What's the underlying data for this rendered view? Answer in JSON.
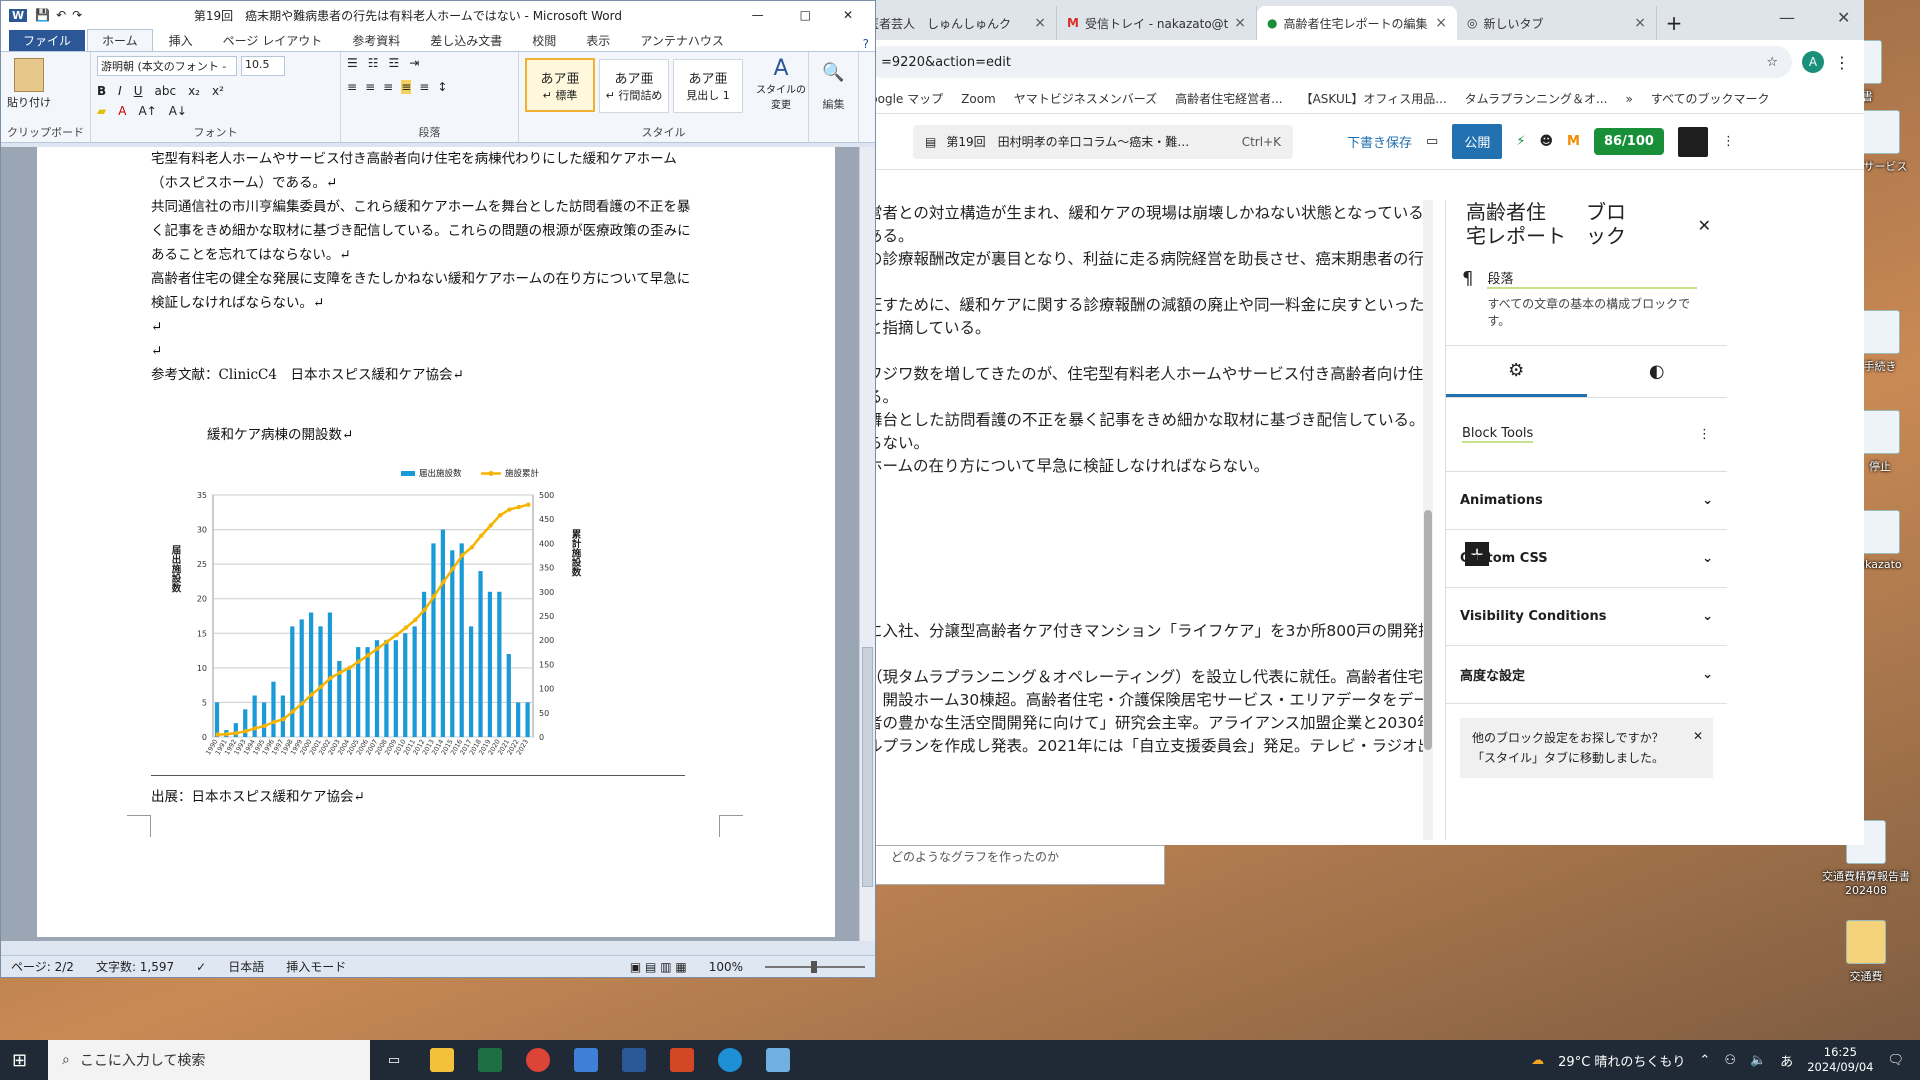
{
  "desktop": {
    "icons": [
      {
        "label": "ーサービス",
        "x_hint": "right"
      },
      {
        "label": "手続き"
      },
      {
        "label": "停止"
      },
      {
        "label": "akazato"
      },
      {
        "label": "交通費精算報告書\n202408"
      },
      {
        "label": "交通費"
      }
    ],
    "top_icons": [
      "文書"
    ]
  },
  "browser": {
    "tabs": [
      {
        "label": "医者芸人　しゅんしゅんク",
        "active": false
      },
      {
        "label": "受信トレイ - nakazato@ta",
        "active": false
      },
      {
        "label": "高齢者住宅レポートの編集",
        "active": true
      },
      {
        "label": "新しいタブ",
        "active": false
      }
    ],
    "url": "=9220&action=edit",
    "bookmarks": [
      "Google マップ",
      "Zoom",
      "ヤマトビジネスメンバーズ",
      "高齢者住宅経営者...",
      "【ASKUL】オフィス用品...",
      "タムラプランニング＆オ...",
      "すべてのブックマーク"
    ],
    "wp": {
      "doc_title": "第19回　田村明孝の辛口コラム〜癌末・難…",
      "shortcut": "Ctrl+K",
      "save_draft": "下書き保存",
      "publish": "公開",
      "score": "86/100"
    },
    "editor_lines": [
      "営者との対立構造が生まれ、緩和ケアの現場は崩壊しかねない状態となっている。",
      "ある。",
      "の診療報酬改定が裏目となり、利益に走る病院経営を助長させ、癌末期患者の行き場",
      "",
      "正すために、緩和ケアに関する診療報酬の減額の廃止や同一料金に戻すといった改善",
      "と指摘している。",
      "",
      "ワジワ数を増してきたのが、住宅型有料老人ホームやサービス付き高齢者向け住宅を",
      "る。",
      "舞台とした訪問看護の不正を暴く記事をきめ細かな取材に基づき配信している。これ",
      "らない。",
      "ホームの在り方について早急に検証しなければならない。"
    ],
    "editor_lines_2": [
      "に入社、分譲型高齢者ケア付きマンション「ライフケア」を3か所800戸の開発担当",
      "",
      "（現タムラプランニング＆オペレーティング）を設立し代表に就任。高齢者住宅開",
      "。開設ホーム30棟超。高齢者住宅・介護保険居宅サービス・エリアデータをデータベ",
      "者の豊かな生活空間開発に向けて」研究会主宰。アライアンス加盟企業と2030年の",
      "ルプランを作成し発表。2021年には「自立支援委員会」発足。テレビ・ラジオ出演"
    ],
    "sidebar": {
      "top_title": "高齢者住　　ブロ",
      "top_sub": "宅レポート　ック",
      "block_name": "段落",
      "block_desc": "すべての文章の基本の構成ブロックです。",
      "block_tools": "Block Tools",
      "panels": [
        "Animations",
        "Custom CSS",
        "Visibility Conditions",
        "高度な設定"
      ],
      "notice": "他のブロック設定をお探しですか？「スタイル」タブに移動しました。"
    }
  },
  "word": {
    "title": "第19回　癌末期や難病患者の行先は有料老人ホームではない - Microsoft Word",
    "tabs": [
      "ファイル",
      "ホーム",
      "挿入",
      "ページ レイアウト",
      "参考資料",
      "差し込み文書",
      "校閲",
      "表示",
      "アンテナハウス"
    ],
    "font_name": "游明朝 (本文のフォント -",
    "font_size": "10.5",
    "groups": {
      "clipboard": "クリップボード",
      "font": "フォント",
      "paragraph": "段落",
      "style": "スタイル",
      "edit": "編集"
    },
    "paste": "貼り付け",
    "styles": [
      {
        "sample": "あア亜",
        "name": "↵ 標準",
        "selected": true
      },
      {
        "sample": "あア亜",
        "name": "↵ 行間詰め",
        "selected": false
      },
      {
        "sample": "あア亜",
        "name": "見出し 1",
        "selected": false
      }
    ],
    "style_change": "スタイルの変更",
    "doc_lines": [
      "宅型有料老人ホームやサービス付き高齢者向け住宅を病棟代わりにした緩和ケアホーム",
      "（ホスピスホーム）である。↵",
      "共同通信社の市川亨編集委員が、これら緩和ケアホームを舞台とした訪問看護の不正を暴",
      "く記事をきめ細かな取材に基づき配信している。これらの問題の根源が医療政策の歪みに",
      "あることを忘れてはならない。↵",
      "高齢者住宅の健全な発展に支障をきたしかねない緩和ケアホームの在り方について早急に",
      "検証しなければならない。↵",
      "↵",
      "↵",
      "参考文献：ClinicC4　日本ホスピス緩和ケア協会↵"
    ],
    "source": "出展：日本ホスピス緩和ケア協会↵",
    "status": {
      "page": "ページ: 2/2",
      "words": "文字数: 1,597",
      "lang": "日本語",
      "mode": "挿入モード",
      "zoom": "100%"
    }
  },
  "chart_data": {
    "type": "bar",
    "title": "緩和ケア病棟の開設数↵",
    "categories": [
      "1990",
      "1991",
      "1992",
      "1993",
      "1994",
      "1995",
      "1996",
      "1997",
      "1998",
      "1999",
      "2000",
      "2001",
      "2002",
      "2003",
      "2004",
      "2005",
      "2006",
      "2007",
      "2008",
      "2009",
      "2010",
      "2011",
      "2012",
      "2013",
      "2014",
      "2015",
      "2016",
      "2017",
      "2018",
      "2019",
      "2020",
      "2021",
      "2022",
      "2023"
    ],
    "series": [
      {
        "name": "届出施設数",
        "type": "bar",
        "axis": "left",
        "values": [
          5,
          1,
          2,
          4,
          6,
          5,
          8,
          6,
          16,
          17,
          18,
          16,
          18,
          11,
          10,
          13,
          13,
          14,
          14,
          14,
          15,
          16,
          21,
          28,
          30,
          27,
          28,
          16,
          24,
          21,
          21,
          12,
          5,
          5
        ]
      },
      {
        "name": "施設累計",
        "type": "line",
        "axis": "right",
        "values": [
          5,
          6,
          8,
          12,
          18,
          23,
          31,
          37,
          53,
          70,
          88,
          104,
          122,
          133,
          143,
          156,
          169,
          183,
          197,
          211,
          226,
          242,
          263,
          291,
          321,
          348,
          376,
          392,
          416,
          437,
          458,
          470,
          475,
          480
        ]
      }
    ],
    "ylabel": "届出施設数",
    "ylabel_right": "累計施設数",
    "ylim": [
      0,
      35
    ],
    "y_ticks": [
      0,
      5,
      10,
      15,
      20,
      25,
      30,
      35
    ],
    "ylim_right": [
      0,
      500
    ],
    "y_ticks_right": [
      0,
      50,
      100,
      150,
      200,
      250,
      300,
      350,
      400,
      450,
      500
    ],
    "legend": "top-right",
    "colors": {
      "bars": "#1a9ad6",
      "line": "#f5b400"
    }
  },
  "taskbar": {
    "search_placeholder": "ここに入力して検索",
    "weather": "29°C 晴れのちくもり",
    "time": "16:25",
    "date": "2024/09/04",
    "ime": "あ"
  },
  "behind_window": {
    "text": "どのようなグラフを作ったのか"
  }
}
